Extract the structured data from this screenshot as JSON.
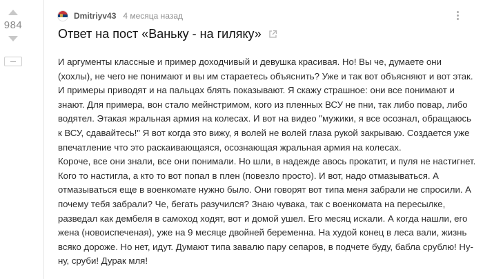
{
  "vote": {
    "score": "984"
  },
  "comment": {
    "username": "Dmitriyv43",
    "timestamp": "4 месяца назад",
    "flag_colors": [
      "#c6363c",
      "#0c4076",
      "#ffffff"
    ],
    "title": "Ответ на пост «Ваньку - на гиляку»",
    "lines": [
      "И аргументы классные и пример доходчивый и девушка красивая. Но! Вы че, думаете они",
      "(хохлы), не чего не понимают и вы им стараетесь объяснить? Уже и так вот объясняют и вот этак.",
      "И примеры приводят и на пальцах блять показывают. Я скажу страшное: они все понимают и",
      "знают. Для примера, вон стало мейнстримом, кого из пленных ВСУ не пни, так либо повар, либо",
      "водятел. Этакая жральная армия на колесах. И вот на видео \"мужики, я все осознал, обращаюсь",
      "к ВСУ, сдавайтесь!\" Я вот когда это вижу, я волей не волей глаза рукой закрываю. Создается уже",
      "впечатление что это раскаивающаяся, осознающая жральная армия на колесах.",
      "Короче, все они знали, все они понимали. Но шли, в надежде авось прокатит, и пуля не настигнет.",
      "Кого то настигла, а кто то вот попал в плен (повезло просто). И вот, надо отмазываться. А",
      "отмазываться еще в военкомате нужно было. Они говорят вот типа меня забрали не спросили. А",
      "почему тебя забрали? Че, бегать разучился? Знаю чувака, так с военкомата на пересылке,",
      "разведал как дембеля в самоход ходят, вот и домой ушел. Его месяц искали. А когда нашли, его",
      "жена (новоиспеченая), уже на 9 месяце двойней беременна. На худой конец в леса вали, жизнь",
      "всяко дороже. Но нет, идут. Думают типа завалю пару сепаров, в подчете буду, бабла срублю! Ну-",
      "ну, сруби! Дурак мля!"
    ]
  }
}
